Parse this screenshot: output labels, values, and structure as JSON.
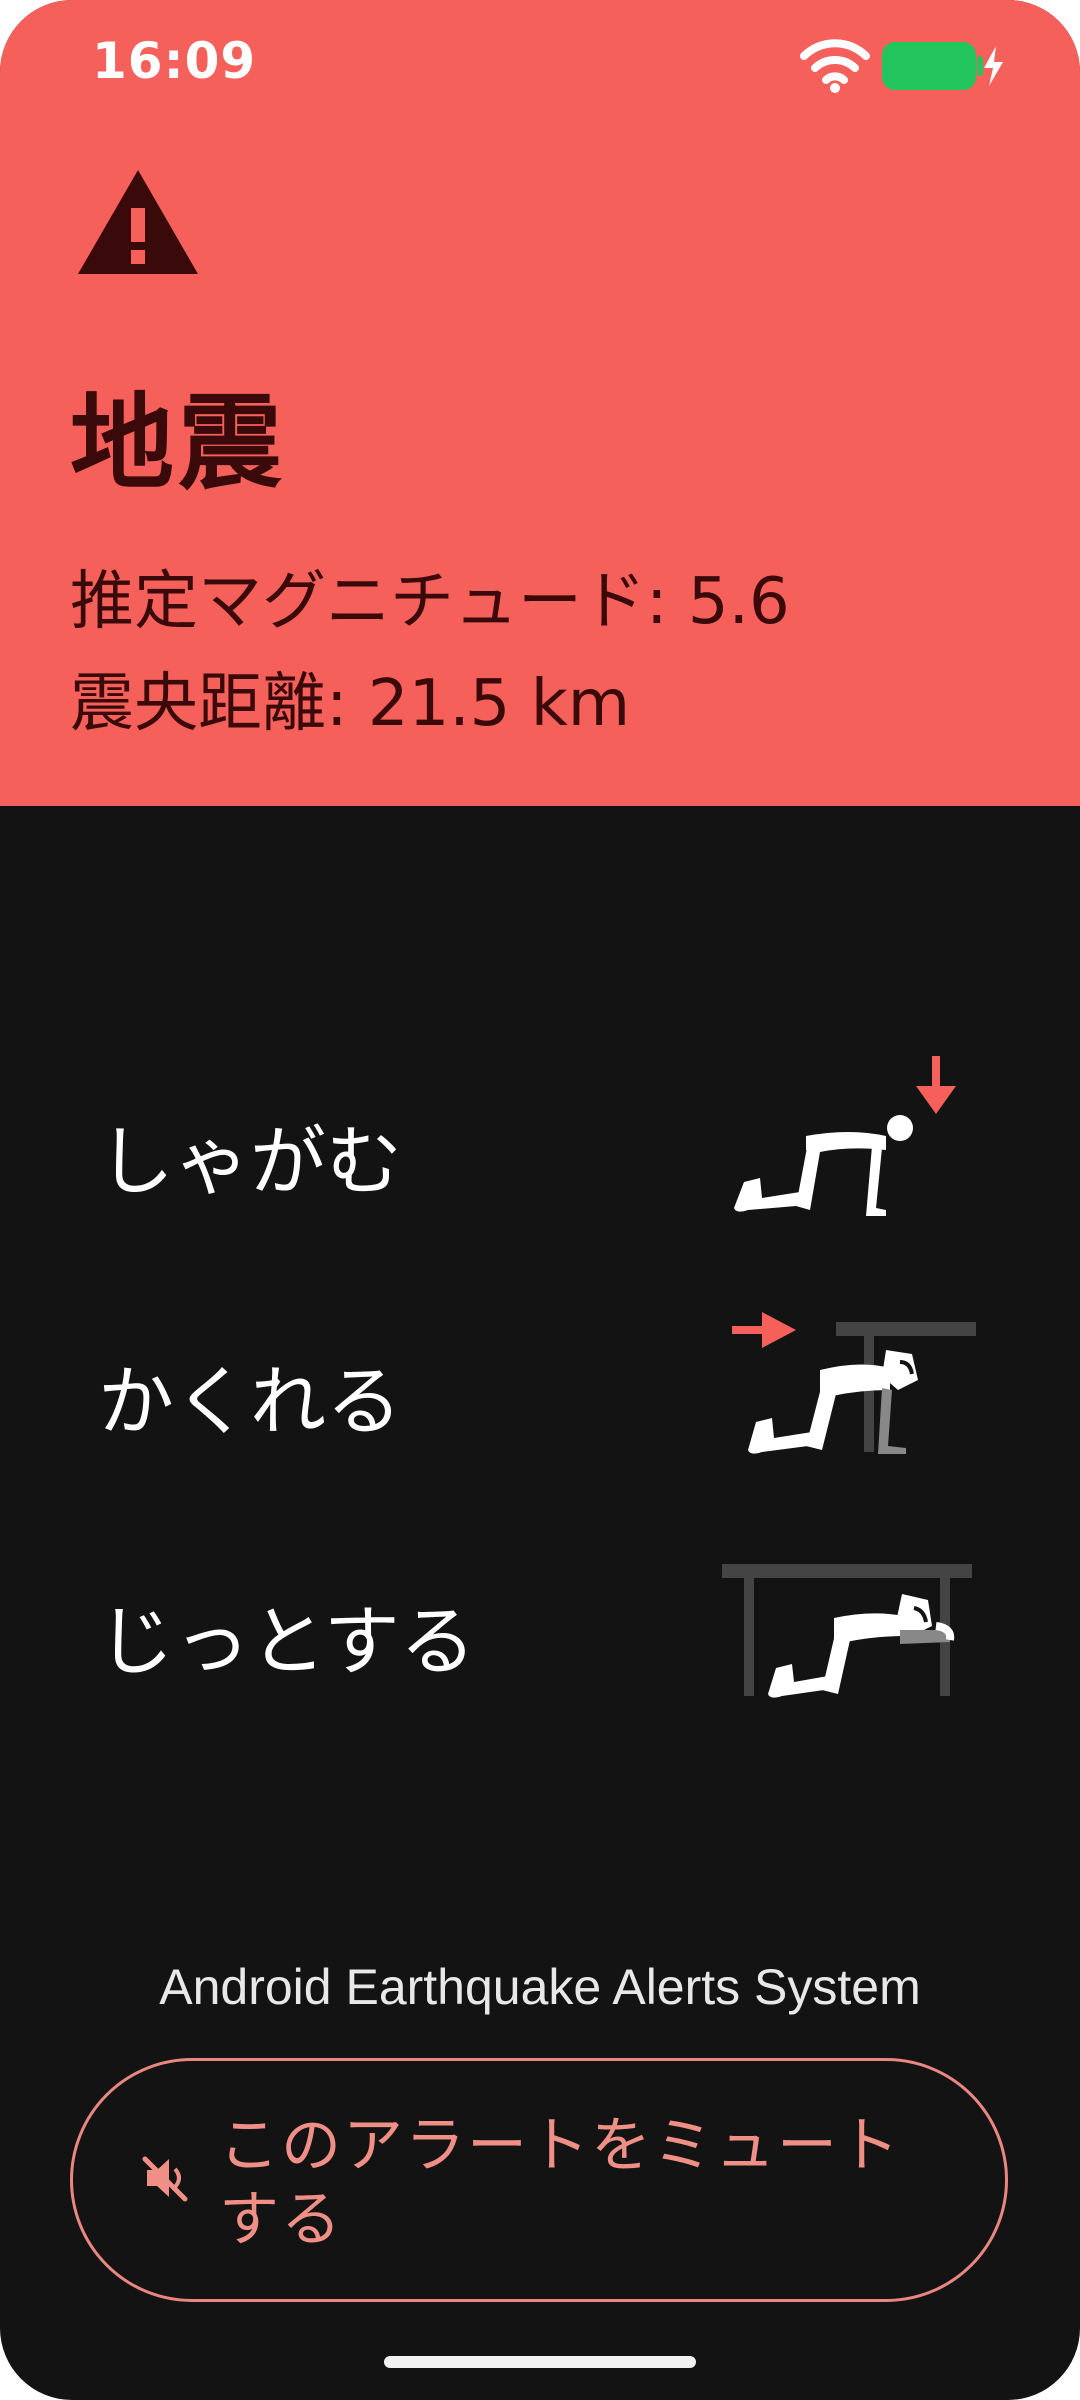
{
  "status_bar": {
    "time": "16:09"
  },
  "alert": {
    "title": "地震",
    "magnitude_text": "推定マグニチュード: 5.6",
    "distance_text": "震央距離: 21.5 km",
    "background_color": "#f6605a",
    "icon": "warning-icon"
  },
  "instructions": [
    {
      "label": "しゃがむ",
      "icon": "drop-illustration"
    },
    {
      "label": "かくれる",
      "icon": "cover-illustration"
    },
    {
      "label": "じっとする",
      "icon": "hold-illustration"
    }
  ],
  "footer": {
    "system_name": "Android Earthquake Alerts System"
  },
  "mute_button": {
    "label": "このアラートをミュートする",
    "icon": "volume-off-icon",
    "accent_color": "#ef8f86"
  }
}
